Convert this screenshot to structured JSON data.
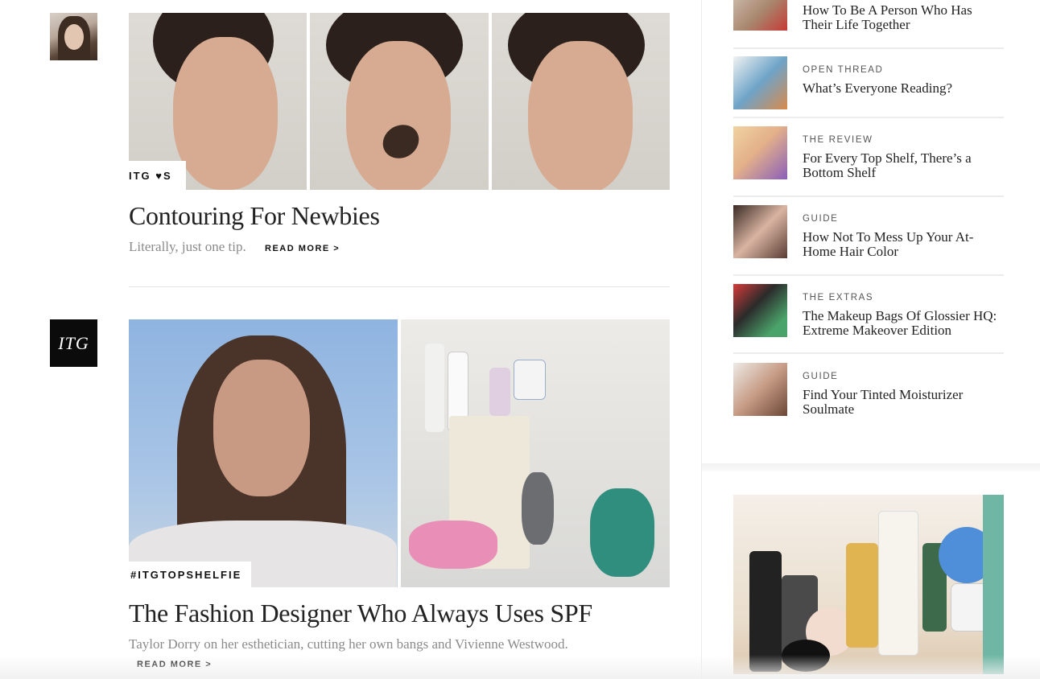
{
  "feed": {
    "posts": [
      {
        "tag": "ITG ♥S",
        "title": "Contouring For Newbies",
        "dek": "Literally, just one tip.",
        "read_more": "READ MORE >"
      },
      {
        "avatar_text": "ITG",
        "tag": "#ITGTOPSHELFIE",
        "title": "The Fashion Designer Who Always Uses SPF",
        "dek": "Taylor Dorry on her esthetician, cutting her own bangs and Vivienne Westwood.",
        "read_more": "READ MORE >"
      }
    ]
  },
  "rail": {
    "items": [
      {
        "kicker": "",
        "headline": "How To Be A Person Who Has Their Life Together",
        "thumb_color": "#c9b8a8"
      },
      {
        "kicker": "OPEN THREAD",
        "headline": "What’s Everyone Reading?",
        "thumb_color": "#5f9bbf"
      },
      {
        "kicker": "THE REVIEW",
        "headline": "For Every Top Shelf, There’s a Bottom Shelf",
        "thumb_color": "#c99a6a"
      },
      {
        "kicker": "GUIDE",
        "headline": "How Not To Mess Up Your At-Home Hair Color",
        "thumb_color": "#6b4a3c"
      },
      {
        "kicker": "THE EXTRAS",
        "headline": "The Makeup Bags Of Glossier HQ: Extreme Makeover Edition",
        "thumb_color": "#b7424a"
      },
      {
        "kicker": "GUIDE",
        "headline": "Find Your Tinted Moisturizer Soulmate",
        "thumb_color": "#b08a76"
      }
    ]
  }
}
